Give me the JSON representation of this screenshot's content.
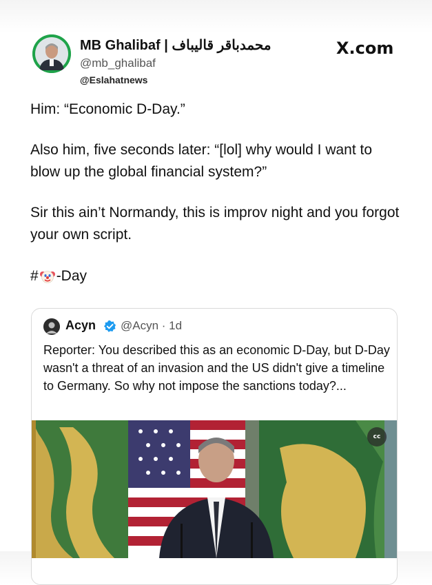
{
  "author": {
    "name": "MB Ghalibaf | محمدباقر قالیباف",
    "handle": "@mb_ghalibaf",
    "watermark": "@Eslahatnews"
  },
  "site": "X.com",
  "post": {
    "line1": "Him: “Economic D-Day.”",
    "line2": "Also him, five seconds later: “[lol] why would I want to blow up the global financial system?”",
    "line3": "Sir this ain’t Normandy, this is improv night and you forgot your own script.",
    "hashtag_prefix": "#",
    "hashtag_suffix": "-Day",
    "hashtag_icon": "clown-face-icon"
  },
  "quote": {
    "name": "Acyn",
    "handle_time": "@Acyn · 1d",
    "text": "Reporter: You described this as an economic D-Day, but D-Day wasn't a threat of an invasion and the US didn't give a timeline to Germany. So why not impose the sanctions today?...",
    "cc_label": "cc"
  },
  "colors": {
    "avatar_green": "#1fa34a",
    "verified_blue": "#1d9bf0"
  }
}
